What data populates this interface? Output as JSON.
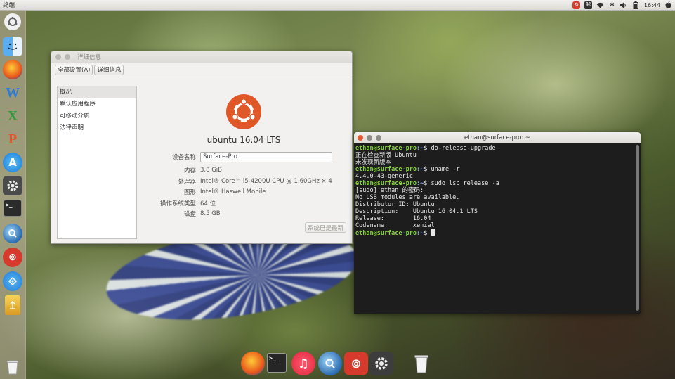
{
  "top_panel": {
    "app_title": "终端",
    "clock": "16:44",
    "indicators": [
      "netease-music-indicator",
      "keyboard-command-indicator",
      "wifi-icon",
      "bluetooth-icon",
      "volume-icon",
      "battery-icon",
      "clock",
      "apple-icon"
    ]
  },
  "launcher": {
    "items": [
      "dash-icon",
      "finder-icon",
      "firefox-icon",
      "wps-writer-icon",
      "wps-spreadsheet-icon",
      "wps-presentation-icon",
      "app-store-icon",
      "system-settings-icon",
      "terminal-icon",
      "quicktime-icon",
      "netease-music-icon",
      "migration-assistant-icon",
      "usb-disk-icon",
      "trash-icon"
    ]
  },
  "details": {
    "title": "详细信息",
    "toolbar": {
      "all_settings": "全部设置(A)",
      "details": "详细信息"
    },
    "sidebar": [
      "概况",
      "默认应用程序",
      "可移动介质",
      "法律声明"
    ],
    "selected_index": 0,
    "os_name": "ubuntu 16.04 LTS",
    "device_name_label": "设备名称",
    "device_name_value": "Surface-Pro",
    "rows": [
      {
        "label": "内存",
        "value": "3.8 GiB"
      },
      {
        "label": "处理器",
        "value": "Intel® Core™ i5-4200U CPU @ 1.60GHz × 4"
      },
      {
        "label": "图形",
        "value": "Intel® Haswell Mobile"
      },
      {
        "label": "操作系统类型",
        "value": "64 位"
      },
      {
        "label": "磁盘",
        "value": "8.5 GB"
      }
    ],
    "update_button": "系统已是最新"
  },
  "terminal": {
    "title": "ethan@surface-pro: ~",
    "prompt_user": "ethan@surface-pro",
    "prompt_path": ":~",
    "prompt_symbol": "$ ",
    "lines": [
      {
        "type": "cmd",
        "text": "do-release-upgrade"
      },
      {
        "type": "out",
        "text": "正在检查新版 Ubuntu"
      },
      {
        "type": "out",
        "text": "未发现新版本"
      },
      {
        "type": "cmd",
        "text": "uname -r"
      },
      {
        "type": "out",
        "text": "4.4.0-43-generic"
      },
      {
        "type": "cmd",
        "text": "sudo lsb_release -a"
      },
      {
        "type": "out",
        "text": "[sudo] ethan 的密码:"
      },
      {
        "type": "out",
        "text": "No LSB modules are available."
      },
      {
        "type": "out",
        "text": "Distributor ID:\tUbuntu"
      },
      {
        "type": "out",
        "text": "Description:\tUbuntu 16.04.1 LTS"
      },
      {
        "type": "out",
        "text": "Release:\t16.04"
      },
      {
        "type": "out",
        "text": "Codename:\txenial"
      },
      {
        "type": "cmd",
        "text": "",
        "cursor": true
      }
    ]
  },
  "dock": {
    "items": [
      "firefox-icon",
      "terminal-icon",
      "itunes-icon",
      "quicktime-icon",
      "netease-music-icon",
      "system-settings-icon",
      "trash-icon"
    ]
  },
  "colors": {
    "ubuntu_orange": "#e05828",
    "prompt_green": "#86d23b",
    "prompt_blue": "#7aa6da",
    "terminal_bg": "#1d1d1d"
  }
}
